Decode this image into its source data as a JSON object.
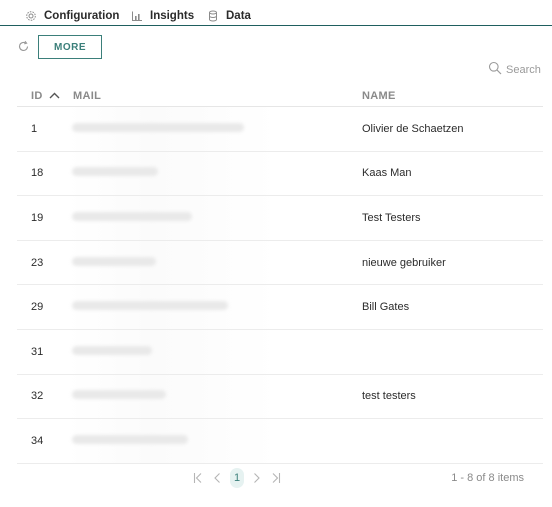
{
  "tabs": [
    {
      "label": "Configuration",
      "icon": "gear-icon"
    },
    {
      "label": "Insights",
      "icon": "chart-icon"
    },
    {
      "label": "Data",
      "icon": "database-icon"
    }
  ],
  "toolbar": {
    "more_label": "MORE",
    "refresh_icon": "refresh-icon"
  },
  "search": {
    "placeholder": "Search"
  },
  "table": {
    "columns": {
      "id": "ID",
      "mail": "MAIL",
      "name": "NAME"
    },
    "sort": "id-ascending",
    "rows": [
      {
        "id": "1",
        "name": "Olivier de Schaetzen"
      },
      {
        "id": "18",
        "name": "Kaas Man"
      },
      {
        "id": "19",
        "name": "Test Testers"
      },
      {
        "id": "23",
        "name": "nieuwe gebruiker"
      },
      {
        "id": "29",
        "name": "Bill Gates"
      },
      {
        "id": "31",
        "name": ""
      },
      {
        "id": "32",
        "name": "test testers"
      },
      {
        "id": "34",
        "name": ""
      }
    ]
  },
  "pager": {
    "current_page": "1",
    "info": "1 - 8 of 8 items"
  },
  "colors": {
    "accent": "#3b7f7a",
    "tab_underline": "#1f5f5f",
    "muted": "#8a8a8a"
  }
}
